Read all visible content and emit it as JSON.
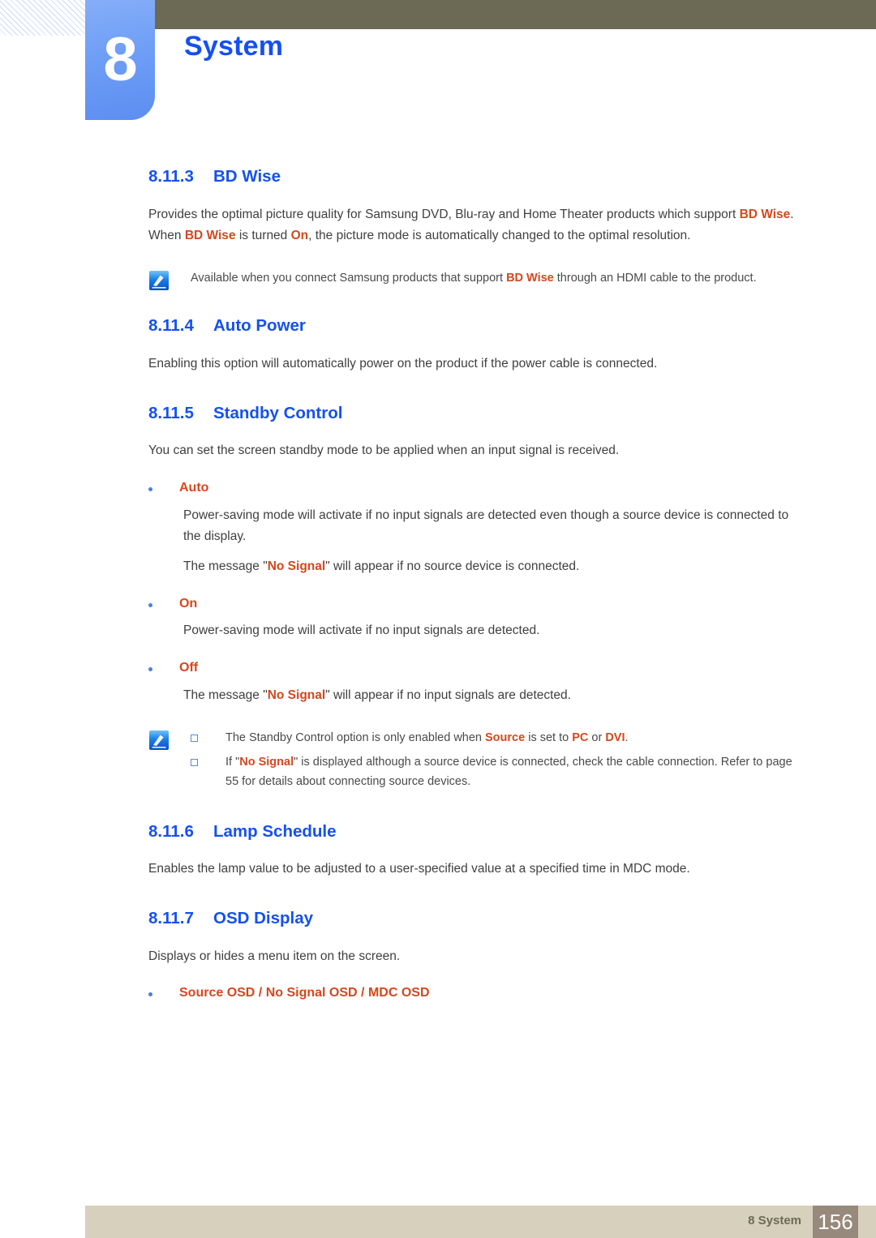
{
  "header": {
    "chapter_number": "8",
    "chapter_title": "System",
    "accent_blue": "#1550f0",
    "tab_blue": "#6f9ef6",
    "olive": "#6c6a55"
  },
  "sections": [
    {
      "number": "8.11.3",
      "title": "BD Wise",
      "paragraph_parts": [
        {
          "text": "Provides the optimal picture quality for Samsung DVD, Blu-ray and Home Theater products which support ",
          "emphasis": false
        },
        {
          "text": "BD Wise",
          "emphasis": true
        },
        {
          "text": ". When ",
          "emphasis": false
        },
        {
          "text": "BD Wise",
          "emphasis": true
        },
        {
          "text": " is turned ",
          "emphasis": false
        },
        {
          "text": "On",
          "emphasis": true
        },
        {
          "text": ", the picture mode is automatically changed to the optimal resolution.",
          "emphasis": false
        }
      ],
      "note": {
        "icon": "note-pencil-icon",
        "parts": [
          {
            "text": "Available when you connect Samsung products that support ",
            "emphasis": false
          },
          {
            "text": "BD Wise",
            "emphasis": true
          },
          {
            "text": " through an HDMI cable to the product.",
            "emphasis": false
          }
        ]
      }
    },
    {
      "number": "8.11.4",
      "title": "Auto Power",
      "paragraph": "Enabling this option will automatically power on the product if the power cable is connected."
    },
    {
      "number": "8.11.5",
      "title": "Standby Control",
      "paragraph": "You can set the screen standby mode to be applied when an input signal is received.",
      "bullets": [
        {
          "label": "Auto",
          "lines": [
            [
              {
                "text": "Power-saving mode will activate if no input signals are detected even though a source device is connected to the display.",
                "emphasis": false
              }
            ],
            [
              {
                "text": "The message \"",
                "emphasis": false
              },
              {
                "text": "No Signal",
                "emphasis": true
              },
              {
                "text": "\" will appear if no source device is connected.",
                "emphasis": false
              }
            ]
          ]
        },
        {
          "label": "On",
          "lines": [
            [
              {
                "text": "Power-saving mode will activate if no input signals are detected.",
                "emphasis": false
              }
            ]
          ]
        },
        {
          "label": "Off",
          "lines": [
            [
              {
                "text": "The message \"",
                "emphasis": false
              },
              {
                "text": "No Signal",
                "emphasis": true
              },
              {
                "text": "\" will appear if no input signals are detected.",
                "emphasis": false
              }
            ]
          ]
        }
      ],
      "note": {
        "icon": "note-pencil-icon",
        "sub_items": [
          [
            {
              "text": "The Standby Control option is only enabled when ",
              "emphasis": false
            },
            {
              "text": "Source",
              "emphasis": true
            },
            {
              "text": " is set to ",
              "emphasis": false
            },
            {
              "text": "PC",
              "emphasis": true
            },
            {
              "text": " or ",
              "emphasis": false
            },
            {
              "text": "DVI",
              "emphasis": true
            },
            {
              "text": ".",
              "emphasis": false
            }
          ],
          [
            {
              "text": "If \"",
              "emphasis": false
            },
            {
              "text": "No Signal",
              "emphasis": true
            },
            {
              "text": "\" is displayed although a source device is connected, check the cable connection. Refer to page 55 for details about connecting source devices.",
              "emphasis": false
            }
          ]
        ]
      }
    },
    {
      "number": "8.11.6",
      "title": "Lamp Schedule",
      "paragraph": "Enables the lamp value to be adjusted to a user-specified value at a specified time in MDC mode."
    },
    {
      "number": "8.11.7",
      "title": "OSD Display",
      "paragraph": "Displays or hides a menu item on the screen.",
      "bullets": [
        {
          "label_parts": [
            {
              "text": "Source OSD",
              "emphasis": true
            },
            {
              "text": " / ",
              "emphasis": false
            },
            {
              "text": "No Signal OSD",
              "emphasis": true
            },
            {
              "text": " / ",
              "emphasis": false
            },
            {
              "text": "MDC OSD",
              "emphasis": true
            }
          ],
          "lines": []
        }
      ]
    }
  ],
  "footer": {
    "label": "8 System",
    "page_number": "156",
    "bar_color": "#d6d0bc",
    "page_box_color": "#97897c"
  },
  "colors": {
    "heading_blue": "#1550f0",
    "emphasis_orange": "#d4481e",
    "body_gray": "#404040",
    "bullet_blue": "#4a7fe0"
  }
}
